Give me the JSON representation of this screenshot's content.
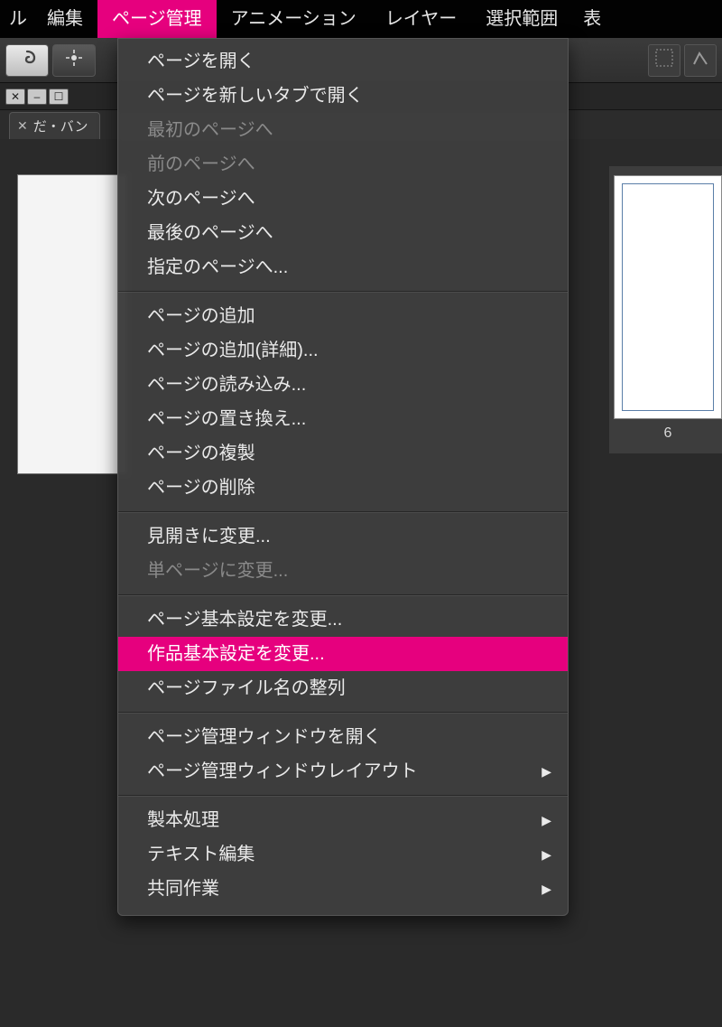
{
  "menubar": {
    "trail": "ル",
    "items": [
      "編集",
      "ページ管理",
      "アニメーション",
      "レイヤー",
      "選択範囲"
    ],
    "tail": "表",
    "activeIndex": 1
  },
  "tab": {
    "close": "✕",
    "label": "だ・バン"
  },
  "thumb": {
    "label": "6"
  },
  "dropdown": {
    "g1": [
      "ページを開く",
      "ページを新しいタブで開く"
    ],
    "g1d": [
      "最初のページへ",
      "前のページへ"
    ],
    "g1b": [
      "次のページへ",
      "最後のページへ",
      "指定のページへ..."
    ],
    "g2": [
      "ページの追加",
      "ページの追加(詳細)...",
      "ページの読み込み...",
      "ページの置き換え...",
      "ページの複製",
      "ページの削除"
    ],
    "g3a": "見開きに変更...",
    "g3b": "単ページに変更...",
    "g4": [
      "ページ基本設定を変更...",
      "作品基本設定を変更...",
      "ページファイル名の整列"
    ],
    "g5a": "ページ管理ウィンドウを開く",
    "g5b": "ページ管理ウィンドウレイアウト",
    "g6": [
      "製本処理",
      "テキスト編集",
      "共同作業"
    ]
  }
}
